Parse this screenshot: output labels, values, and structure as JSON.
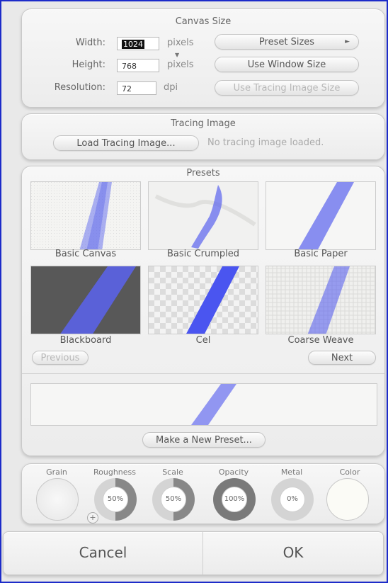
{
  "canvas_size": {
    "title": "Canvas Size",
    "width_label": "Width:",
    "width_value": "1024",
    "height_label": "Height:",
    "height_value": "768",
    "resolution_label": "Resolution:",
    "resolution_value": "72",
    "pixels_unit": "pixels",
    "dpi_unit": "dpi",
    "preset_sizes_label": "Preset Sizes",
    "use_window_size_label": "Use Window Size",
    "use_tracing_size_label": "Use Tracing Image Size"
  },
  "tracing": {
    "title": "Tracing Image",
    "load_label": "Load Tracing Image...",
    "status": "No tracing image loaded."
  },
  "presets": {
    "title": "Presets",
    "items": [
      {
        "label": "Basic Canvas"
      },
      {
        "label": "Basic Crumpled"
      },
      {
        "label": "Basic Paper"
      },
      {
        "label": "Blackboard"
      },
      {
        "label": "Cel"
      },
      {
        "label": "Coarse Weave"
      }
    ],
    "previous_label": "Previous",
    "next_label": "Next",
    "new_preset_label": "Make a New Preset..."
  },
  "controls": {
    "grain_label": "Grain",
    "roughness_label": "Roughness",
    "roughness_value": "50%",
    "scale_label": "Scale",
    "scale_value": "50%",
    "opacity_label": "Opacity",
    "opacity_value": "100%",
    "metal_label": "Metal",
    "metal_value": "0%",
    "color_label": "Color"
  },
  "actions": {
    "cancel_label": "Cancel",
    "ok_label": "OK"
  },
  "colors": {
    "frame_border": "#1d2cc9",
    "stroke_blue": "#5a63ee",
    "blackboard_bg": "#585858"
  }
}
